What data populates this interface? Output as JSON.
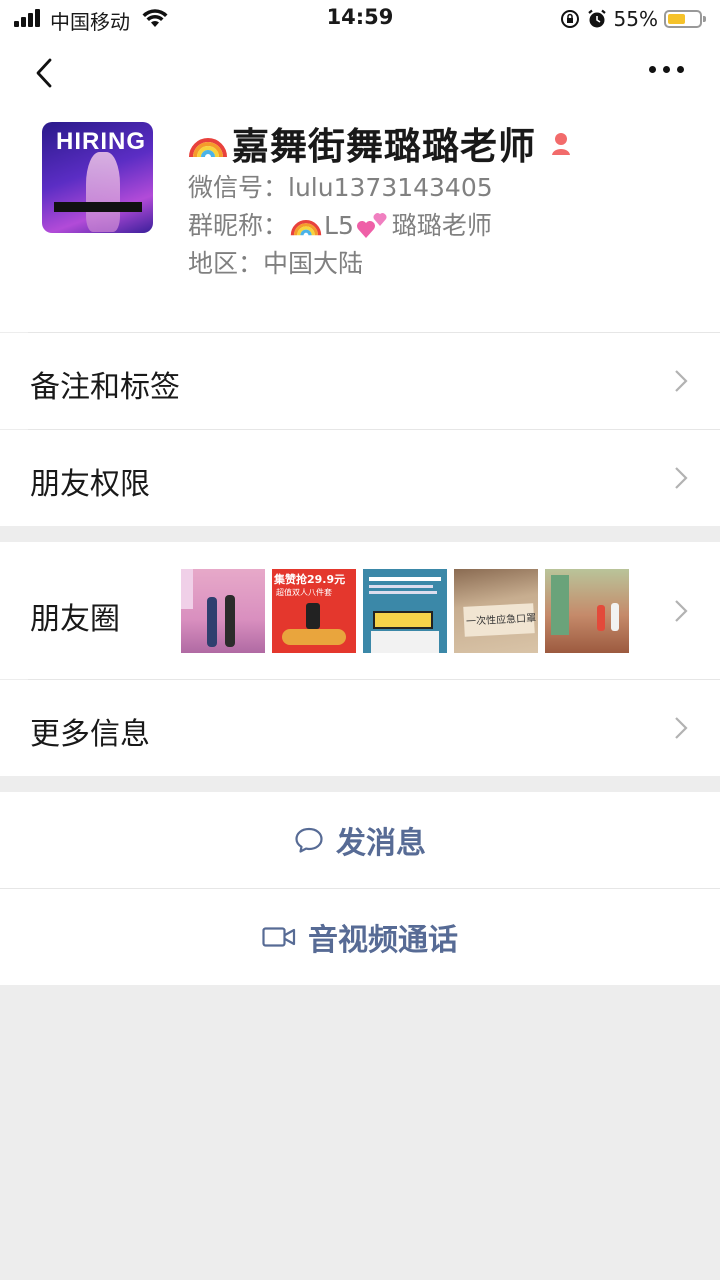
{
  "status_bar": {
    "carrier": "中国移动",
    "time": "14:59",
    "battery_percent": "55%",
    "battery_level": 0.55
  },
  "profile": {
    "name": "嘉舞街舞璐璐老师",
    "wechat_id_label": "微信号：",
    "wechat_id": "lulu1373143405",
    "group_nick_label": "群昵称：",
    "group_nick_a": "L5",
    "group_nick_b": "璐璐老师",
    "region_label": "地区：",
    "region": "中国大陆",
    "avatar_text": "HIRING"
  },
  "rows": {
    "remarks": "备注和标签",
    "permissions": "朋友权限",
    "moments": "朋友圈",
    "more_info": "更多信息"
  },
  "moments_thumbs": [
    {
      "name": "dance-photo"
    },
    {
      "name": "burger-ad",
      "headline": "集赞抢29.9元",
      "subline": "超值双人八件套"
    },
    {
      "name": "comic-poster"
    },
    {
      "name": "sign-photo",
      "caption": "一次性应急口罩"
    },
    {
      "name": "studio-photo"
    }
  ],
  "actions": {
    "message": "发消息",
    "call": "音视频通话"
  },
  "colors": {
    "link": "#576b95",
    "background": "#ededed",
    "secondary_text": "#808080",
    "battery": "#f5c22a",
    "gender_icon": "#f26b6b"
  },
  "icons": [
    "signal-icon",
    "wifi-icon",
    "rotation-lock-icon",
    "alarm-icon",
    "battery-icon",
    "back-arrow-icon",
    "more-dots-icon",
    "rainbow-emoji-icon",
    "female-icon",
    "two-hearts-emoji-icon",
    "chevron-right-icon",
    "chat-bubble-icon",
    "video-camera-icon"
  ]
}
